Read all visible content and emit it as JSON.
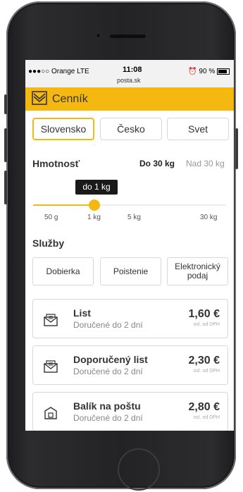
{
  "status_bar": {
    "carrier": "●●●○○ Orange  LTE",
    "time": "11:08",
    "url": "posta.sk",
    "alarm": "⏰",
    "battery": "90 %"
  },
  "app": {
    "title": "Cenník",
    "brand_color": "#f5b811"
  },
  "tabs": [
    {
      "label": "Slovensko",
      "active": true
    },
    {
      "label": "Česko",
      "active": false
    },
    {
      "label": "Svet",
      "active": false
    }
  ],
  "weight": {
    "title": "Hmotnosť",
    "options": [
      {
        "label": "Do 30 kg",
        "active": true
      },
      {
        "label": "Nad 30 kg",
        "active": false
      }
    ],
    "tooltip": "do 1 kg",
    "ticks": [
      "50 g",
      "1 kg",
      "5 kg",
      "30 kg"
    ],
    "selected_index": 1
  },
  "services": {
    "title": "Služby",
    "items": [
      "Dobierka",
      "Poistenie",
      "Elektronický podaj"
    ]
  },
  "products": [
    {
      "name": "List",
      "subtitle": "Doručené do 2 dní",
      "price": "1,60 €",
      "vat": "osl. od DPH",
      "icon": "envelope-icon"
    },
    {
      "name": "Doporučený list",
      "subtitle": "Doručené do 2 dní",
      "price": "2,30 €",
      "vat": "osl. od DPH",
      "icon": "registered-letter-icon"
    },
    {
      "name": "Balík na poštu",
      "subtitle": "Doručené do 2 dní",
      "price": "2,80 €",
      "vat": "osl. od DPH",
      "icon": "parcel-icon"
    }
  ]
}
